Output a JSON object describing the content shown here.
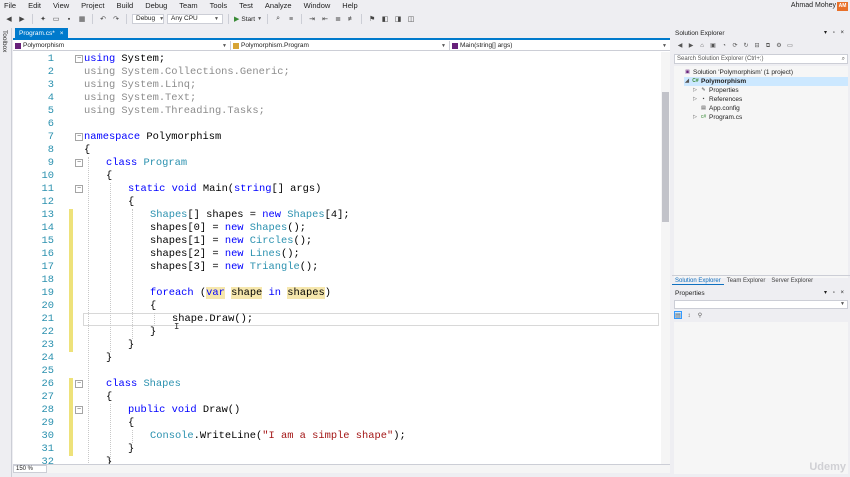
{
  "menu": [
    "File",
    "Edit",
    "View",
    "Project",
    "Build",
    "Debug",
    "Team",
    "Tools",
    "Test",
    "Analyze",
    "Window",
    "Help"
  ],
  "user": {
    "name": "Ahmad Mohey",
    "initials": "AM"
  },
  "toolbar": {
    "config": "Debug",
    "platform": "Any CPU",
    "start": "Start"
  },
  "toolbox_label": "Toolbox",
  "document_tab": {
    "title": "Program.cs*",
    "close": "×"
  },
  "nav_bar": {
    "project": "Polymorphism",
    "type": "Polymorphism.Program",
    "member": "Main(string[] args)"
  },
  "code_lines": [
    {
      "n": "1",
      "indent": 0,
      "parts": [
        {
          "c": "kw",
          "t": "using"
        },
        {
          "c": "",
          "t": " System;"
        }
      ]
    },
    {
      "n": "2",
      "indent": 0,
      "parts": [
        {
          "c": "dim",
          "t": "using System.Collections.Generic;"
        }
      ]
    },
    {
      "n": "3",
      "indent": 0,
      "parts": [
        {
          "c": "dim",
          "t": "using System.Linq;"
        }
      ]
    },
    {
      "n": "4",
      "indent": 0,
      "parts": [
        {
          "c": "dim",
          "t": "using System.Text;"
        }
      ]
    },
    {
      "n": "5",
      "indent": 0,
      "parts": [
        {
          "c": "dim",
          "t": "using System.Threading.Tasks;"
        }
      ]
    },
    {
      "n": "6",
      "indent": 0,
      "parts": []
    },
    {
      "n": "7",
      "indent": 0,
      "parts": [
        {
          "c": "kw",
          "t": "namespace"
        },
        {
          "c": "",
          "t": " Polymorphism"
        }
      ]
    },
    {
      "n": "8",
      "indent": 0,
      "parts": [
        {
          "c": "",
          "t": "{"
        }
      ]
    },
    {
      "n": "9",
      "indent": 1,
      "parts": [
        {
          "c": "kw",
          "t": "class"
        },
        {
          "c": "",
          "t": " "
        },
        {
          "c": "ty",
          "t": "Program"
        }
      ]
    },
    {
      "n": "10",
      "indent": 1,
      "parts": [
        {
          "c": "",
          "t": "{"
        }
      ]
    },
    {
      "n": "11",
      "indent": 2,
      "parts": [
        {
          "c": "kw",
          "t": "static"
        },
        {
          "c": "",
          "t": " "
        },
        {
          "c": "kw",
          "t": "void"
        },
        {
          "c": "",
          "t": " Main("
        },
        {
          "c": "kw",
          "t": "string"
        },
        {
          "c": "",
          "t": "[] args)"
        }
      ]
    },
    {
      "n": "12",
      "indent": 2,
      "parts": [
        {
          "c": "",
          "t": "{"
        }
      ]
    },
    {
      "n": "13",
      "indent": 3,
      "parts": [
        {
          "c": "ty",
          "t": "Shapes"
        },
        {
          "c": "",
          "t": "[] shapes = "
        },
        {
          "c": "kw",
          "t": "new"
        },
        {
          "c": "",
          "t": " "
        },
        {
          "c": "ty",
          "t": "Shapes"
        },
        {
          "c": "",
          "t": "[4];"
        }
      ]
    },
    {
      "n": "14",
      "indent": 3,
      "parts": [
        {
          "c": "",
          "t": "shapes[0] = "
        },
        {
          "c": "kw",
          "t": "new"
        },
        {
          "c": "",
          "t": " "
        },
        {
          "c": "ty",
          "t": "Shapes"
        },
        {
          "c": "",
          "t": "();"
        }
      ]
    },
    {
      "n": "15",
      "indent": 3,
      "parts": [
        {
          "c": "",
          "t": "shapes[1] = "
        },
        {
          "c": "kw",
          "t": "new"
        },
        {
          "c": "",
          "t": " "
        },
        {
          "c": "ty",
          "t": "Circles"
        },
        {
          "c": "",
          "t": "();"
        }
      ]
    },
    {
      "n": "16",
      "indent": 3,
      "parts": [
        {
          "c": "",
          "t": "shapes[2] = "
        },
        {
          "c": "kw",
          "t": "new"
        },
        {
          "c": "",
          "t": " "
        },
        {
          "c": "ty",
          "t": "Lines"
        },
        {
          "c": "",
          "t": "();"
        }
      ]
    },
    {
      "n": "17",
      "indent": 3,
      "parts": [
        {
          "c": "",
          "t": "shapes[3] = "
        },
        {
          "c": "kw",
          "t": "new"
        },
        {
          "c": "",
          "t": " "
        },
        {
          "c": "ty",
          "t": "Triangle"
        },
        {
          "c": "",
          "t": "();"
        }
      ]
    },
    {
      "n": "18",
      "indent": 0,
      "parts": []
    },
    {
      "n": "19",
      "indent": 3,
      "parts": [
        {
          "c": "kw",
          "t": "foreach"
        },
        {
          "c": "",
          "t": " ("
        },
        {
          "c": "kw hl",
          "t": "var"
        },
        {
          "c": "",
          "t": " "
        },
        {
          "c": "hl",
          "t": "shape"
        },
        {
          "c": "",
          "t": " "
        },
        {
          "c": "kw",
          "t": "in"
        },
        {
          "c": "",
          "t": " "
        },
        {
          "c": "hl",
          "t": "shapes"
        },
        {
          "c": "",
          "t": ")"
        }
      ]
    },
    {
      "n": "20",
      "indent": 3,
      "parts": [
        {
          "c": "",
          "t": "{"
        }
      ]
    },
    {
      "n": "21",
      "indent": 4,
      "parts": [
        {
          "c": "",
          "t": "shape.Draw();"
        }
      ]
    },
    {
      "n": "22",
      "indent": 3,
      "parts": [
        {
          "c": "",
          "t": "}"
        }
      ]
    },
    {
      "n": "23",
      "indent": 2,
      "parts": [
        {
          "c": "",
          "t": "}"
        }
      ]
    },
    {
      "n": "24",
      "indent": 1,
      "parts": [
        {
          "c": "",
          "t": "}"
        }
      ]
    },
    {
      "n": "25",
      "indent": 0,
      "parts": []
    },
    {
      "n": "26",
      "indent": 1,
      "parts": [
        {
          "c": "kw",
          "t": "class"
        },
        {
          "c": "",
          "t": " "
        },
        {
          "c": "ty",
          "t": "Shapes"
        }
      ]
    },
    {
      "n": "27",
      "indent": 1,
      "parts": [
        {
          "c": "",
          "t": "{"
        }
      ]
    },
    {
      "n": "28",
      "indent": 2,
      "parts": [
        {
          "c": "kw",
          "t": "public"
        },
        {
          "c": "",
          "t": " "
        },
        {
          "c": "kw",
          "t": "void"
        },
        {
          "c": "",
          "t": " Draw()"
        }
      ]
    },
    {
      "n": "29",
      "indent": 2,
      "parts": [
        {
          "c": "",
          "t": "{"
        }
      ]
    },
    {
      "n": "30",
      "indent": 3,
      "parts": [
        {
          "c": "ty",
          "t": "Console"
        },
        {
          "c": "",
          "t": ".WriteLine("
        },
        {
          "c": "st",
          "t": "\"I am a simple shape\""
        },
        {
          "c": "",
          "t": ");"
        }
      ]
    },
    {
      "n": "31",
      "indent": 2,
      "parts": [
        {
          "c": "",
          "t": "}"
        }
      ]
    },
    {
      "n": "32",
      "indent": 1,
      "parts": [
        {
          "c": "",
          "t": "}"
        }
      ]
    }
  ],
  "zoom": "150 %",
  "solution_explorer": {
    "title": "Solution Explorer",
    "search_placeholder": "Search Solution Explorer (Ctrl+;)",
    "tree": [
      {
        "label": "Solution 'Polymorphism' (1 project)",
        "level": 0,
        "icon": "solution-icon",
        "twisty": ""
      },
      {
        "label": "Polymorphism",
        "level": 1,
        "icon": "csharp-project-icon",
        "twisty": "◢",
        "selected": true
      },
      {
        "label": "Properties",
        "level": 2,
        "icon": "wrench-icon",
        "twisty": "▷"
      },
      {
        "label": "References",
        "level": 2,
        "icon": "references-icon",
        "twisty": "▷"
      },
      {
        "label": "App.config",
        "level": 2,
        "icon": "config-file-icon",
        "twisty": ""
      },
      {
        "label": "Program.cs",
        "level": 2,
        "icon": "csharp-file-icon",
        "twisty": "▷"
      }
    ],
    "tabs": [
      "Solution Explorer",
      "Team Explorer",
      "Server Explorer"
    ]
  },
  "properties": {
    "title": "Properties"
  },
  "colors": {
    "accent": "#007acc",
    "keyword": "#0000ff",
    "type": "#2b91af",
    "string": "#a31515",
    "highlight": "#f6e7ad",
    "change_bar": "#eee27a"
  }
}
